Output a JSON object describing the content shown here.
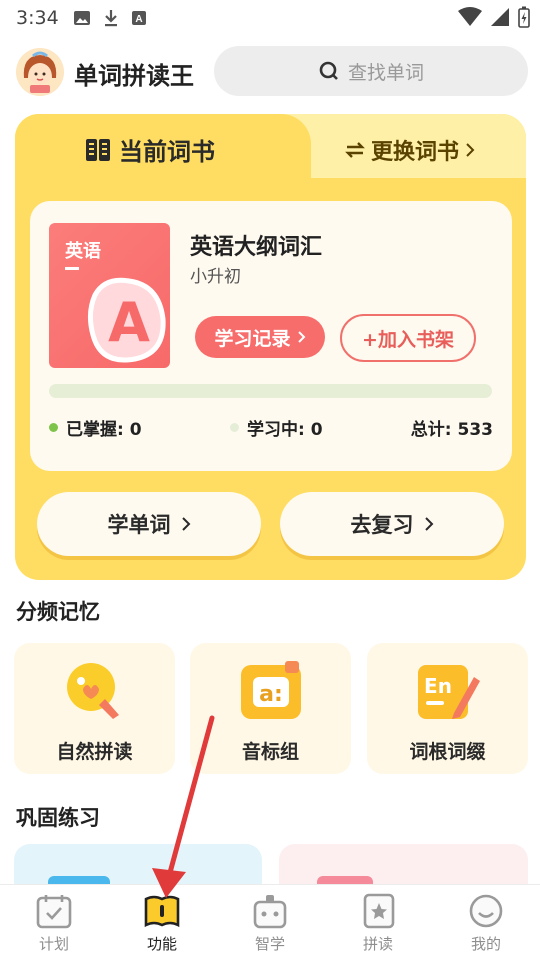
{
  "status_bar": {
    "time": "3:34"
  },
  "header": {
    "app_title": "单词拼读王",
    "search_placeholder": "查找单词"
  },
  "book_card": {
    "tabs": {
      "current": "当前词书",
      "change": "更换词书"
    },
    "book": {
      "cover_text": "英语",
      "cover_letter": "A",
      "title": "英语大纲词汇",
      "level": "小升初"
    },
    "record_button": "学习记录",
    "shelf_button": "+加入书架",
    "progress": 0,
    "stats": {
      "mastered": "已掌握: 0",
      "learning": "学习中: 0",
      "total": "总计: 533"
    },
    "learn_button": "学单词",
    "review_button": "去复习"
  },
  "sections": {
    "frequency": "分频记忆",
    "practice": "巩固练习"
  },
  "features": [
    {
      "label": "自然拼读",
      "icon": "phonics-icon"
    },
    {
      "label": "音标组",
      "icon": "phonetic-icon"
    },
    {
      "label": "词根词缀",
      "icon": "word-root-icon"
    }
  ],
  "tabbar": {
    "active": "功能",
    "items": [
      "计划",
      "功能",
      "智学",
      "拼读",
      "我的"
    ]
  },
  "colors": {
    "brand_yellow": "#fedd62",
    "coral": "#f76d6b",
    "progress_green": "#9acb5a"
  }
}
